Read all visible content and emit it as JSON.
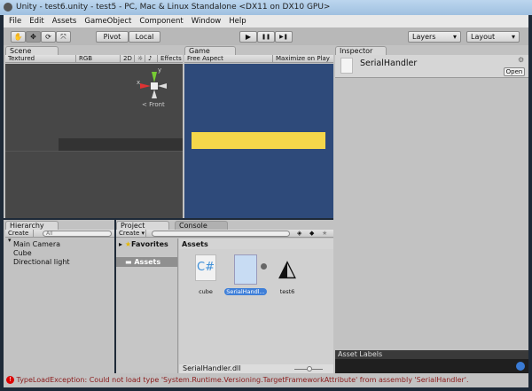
{
  "window": {
    "title": "Unity - test6.unity - test5 - PC, Mac & Linux Standalone <DX11 on DX10 GPU>"
  },
  "menu": [
    "File",
    "Edit",
    "Assets",
    "GameObject",
    "Component",
    "Window",
    "Help"
  ],
  "toolbar": {
    "pivot": "Pivot",
    "local": "Local",
    "layers": "Layers",
    "layout": "Layout",
    "play_icon": "▶",
    "pause_icon": "❚❚",
    "step_icon": "▶❚"
  },
  "scene": {
    "tab": "Scene",
    "shading": "Textured",
    "channel": "RGB",
    "mode2d": "2D",
    "effects": "Effects",
    "gizmo_label": "Front",
    "gizmo_y": "y",
    "gizmo_x": "x"
  },
  "game": {
    "tab": "Game",
    "aspect": "Free Aspect",
    "maximize": "Maximize on Play",
    "background": "#2e4a7a",
    "bar_color": "#f5d74a"
  },
  "inspector": {
    "tab": "Inspector",
    "object": "SerialHandler",
    "open": "Open",
    "asset_labels": "Asset Labels"
  },
  "hierarchy": {
    "tab": "Hierarchy",
    "create": "Create",
    "search_placeholder": "All",
    "items": [
      "Main Camera",
      "Cube",
      "Directional light"
    ]
  },
  "project": {
    "tab": "Project",
    "console_tab": "Console",
    "create": "Create",
    "favorites": "Favorites",
    "assets_folder": "Assets",
    "assets_header": "Assets",
    "items": [
      {
        "name": "cube",
        "icon": "csharp-script-icon"
      },
      {
        "name": "SerialHandl...",
        "icon": "dll-file-icon",
        "selected": true
      },
      {
        "name": "test6",
        "icon": "unity-scene-icon"
      }
    ],
    "selected_path": "SerialHandler.dll"
  },
  "status": {
    "message": "TypeLoadException: Could not load type 'System.Runtime.Versioning.TargetFrameworkAttribute' from assembly 'SerialHandler'.",
    "color": "#8b1a1a"
  }
}
